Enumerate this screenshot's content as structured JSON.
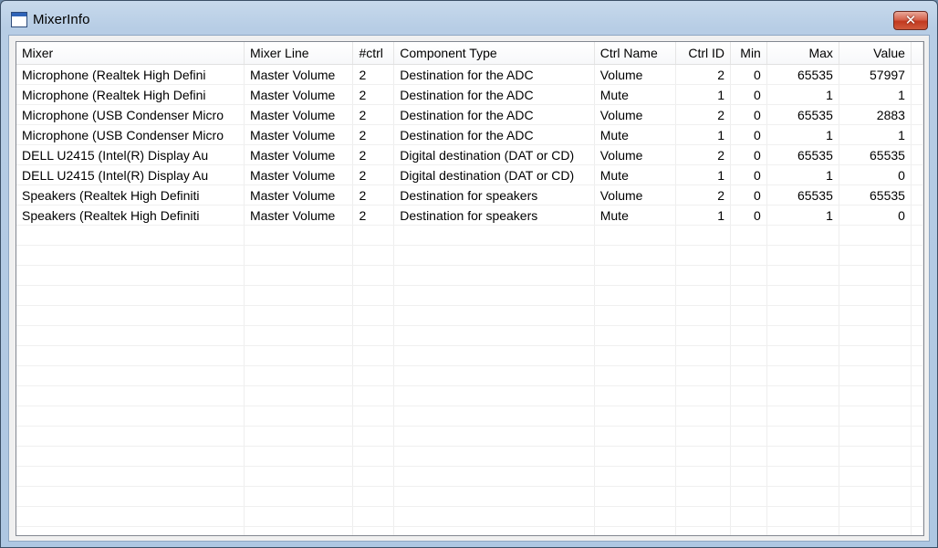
{
  "window": {
    "title": "MixerInfo",
    "close_label": "✕"
  },
  "table": {
    "columns": [
      "Mixer",
      "Mixer Line",
      "#ctrl",
      "Component Type",
      "Ctrl Name",
      "Ctrl ID",
      "Min",
      "Max",
      "Value"
    ],
    "rows": [
      [
        "Microphone (Realtek High Defini",
        "Master Volume",
        "2",
        "Destination for the ADC",
        "Volume",
        "2",
        "0",
        "65535",
        "57997"
      ],
      [
        "Microphone (Realtek High Defini",
        "Master Volume",
        "2",
        "Destination for the ADC",
        "Mute",
        "1",
        "0",
        "1",
        "1"
      ],
      [
        "Microphone (USB Condenser Micro",
        "Master Volume",
        "2",
        "Destination for the ADC",
        "Volume",
        "2",
        "0",
        "65535",
        "2883"
      ],
      [
        "Microphone (USB Condenser Micro",
        "Master Volume",
        "2",
        "Destination for the ADC",
        "Mute",
        "1",
        "0",
        "1",
        "1"
      ],
      [
        "DELL U2415 (Intel(R) Display Au",
        "Master Volume",
        "2",
        "Digital destination (DAT or CD)",
        "Volume",
        "2",
        "0",
        "65535",
        "65535"
      ],
      [
        "DELL U2415 (Intel(R) Display Au",
        "Master Volume",
        "2",
        "Digital destination (DAT or CD)",
        "Mute",
        "1",
        "0",
        "1",
        "0"
      ],
      [
        "Speakers (Realtek High Definiti",
        "Master Volume",
        "2",
        "Destination for speakers",
        "Volume",
        "2",
        "0",
        "65535",
        "65535"
      ],
      [
        "Speakers (Realtek High Definiti",
        "Master Volume",
        "2",
        "Destination for speakers",
        "Mute",
        "1",
        "0",
        "1",
        "0"
      ]
    ]
  }
}
